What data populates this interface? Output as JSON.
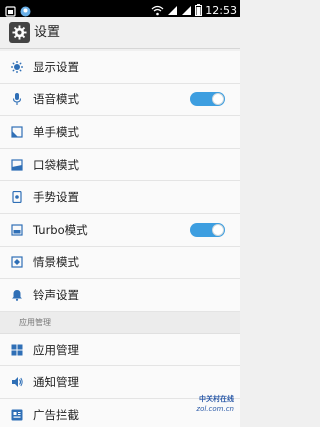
{
  "status_bar": {
    "time": "12:53"
  },
  "app_bar": {
    "title": "设置",
    "icon": "gear-icon"
  },
  "settings": [
    {
      "label": "显示设置",
      "icon": "display-icon"
    },
    {
      "label": "语音模式",
      "icon": "microphone-icon",
      "toggle": true
    },
    {
      "label": "单手模式",
      "icon": "one-hand-icon"
    },
    {
      "label": "口袋模式",
      "icon": "pocket-icon"
    },
    {
      "label": "手势设置",
      "icon": "gesture-icon"
    },
    {
      "label": "Turbo模式",
      "icon": "turbo-icon",
      "toggle": true
    },
    {
      "label": "情景模式",
      "icon": "scene-icon"
    },
    {
      "label": "铃声设置",
      "icon": "bell-icon"
    }
  ],
  "section_header": "应用管理",
  "app_settings": [
    {
      "label": "应用管理",
      "icon": "apps-grid-icon"
    },
    {
      "label": "通知管理",
      "icon": "notification-icon"
    },
    {
      "label": "广告拦截",
      "icon": "ad-block-icon"
    }
  ],
  "watermark": {
    "line1": "中关村在线",
    "line2": "zol.com.cn"
  },
  "colors": {
    "accent": "#3d9ee0",
    "icon": "#2f6fb6"
  }
}
